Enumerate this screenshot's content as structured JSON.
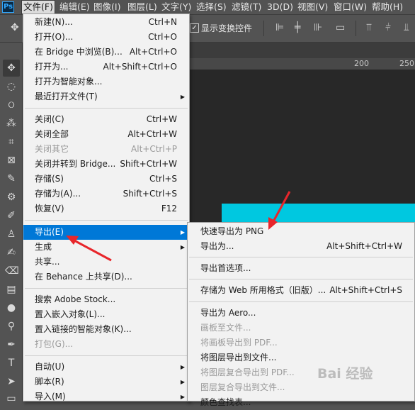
{
  "menubar": {
    "logo": "Ps",
    "items": [
      "文件(F)",
      "编辑(E)",
      "图像(I)",
      "图层(L)",
      "文字(Y)",
      "选择(S)",
      "滤镜(T)",
      "3D(D)",
      "视图(V)",
      "窗口(W)",
      "帮助(H)"
    ]
  },
  "options_bar": {
    "show_transform_label": "显示变换控件",
    "checked": true
  },
  "ruler": {
    "ticks": [
      "200",
      "250"
    ]
  },
  "file_menu": {
    "items": [
      {
        "label": "新建(N)...",
        "shortcut": "Ctrl+N"
      },
      {
        "label": "打开(O)...",
        "shortcut": "Ctrl+O"
      },
      {
        "label": "在 Bridge 中浏览(B)...",
        "shortcut": "Alt+Ctrl+O"
      },
      {
        "label": "打开为...",
        "shortcut": "Alt+Shift+Ctrl+O"
      },
      {
        "label": "打开为智能对象...",
        "shortcut": ""
      },
      {
        "label": "最近打开文件(T)",
        "shortcut": ""
      },
      {
        "label": "关闭(C)",
        "shortcut": "Ctrl+W"
      },
      {
        "label": "关闭全部",
        "shortcut": "Alt+Ctrl+W"
      },
      {
        "label": "关闭其它",
        "shortcut": "Alt+Ctrl+P"
      },
      {
        "label": "关闭并转到 Bridge...",
        "shortcut": "Shift+Ctrl+W"
      },
      {
        "label": "存储(S)",
        "shortcut": "Ctrl+S"
      },
      {
        "label": "存储为(A)...",
        "shortcut": "Shift+Ctrl+S"
      },
      {
        "label": "恢复(V)",
        "shortcut": "F12"
      },
      {
        "label": "导出(E)",
        "shortcut": ""
      },
      {
        "label": "生成",
        "shortcut": ""
      },
      {
        "label": "共享...",
        "shortcut": ""
      },
      {
        "label": "在 Behance 上共享(D)...",
        "shortcut": ""
      },
      {
        "label": "搜索 Adobe Stock...",
        "shortcut": ""
      },
      {
        "label": "置入嵌入对象(L)...",
        "shortcut": ""
      },
      {
        "label": "置入链接的智能对象(K)...",
        "shortcut": ""
      },
      {
        "label": "打包(G)...",
        "shortcut": ""
      },
      {
        "label": "自动(U)",
        "shortcut": ""
      },
      {
        "label": "脚本(R)",
        "shortcut": ""
      },
      {
        "label": "导入(M)",
        "shortcut": ""
      }
    ]
  },
  "export_submenu": {
    "items": [
      {
        "label": "快速导出为 PNG",
        "shortcut": ""
      },
      {
        "label": "导出为...",
        "shortcut": "Alt+Shift+Ctrl+W"
      },
      {
        "label": "导出首选项...",
        "shortcut": ""
      },
      {
        "label": "存储为 Web 所用格式（旧版）...",
        "shortcut": "Alt+Shift+Ctrl+S"
      },
      {
        "label": "导出为 Aero...",
        "shortcut": ""
      },
      {
        "label": "画板至文件...",
        "shortcut": ""
      },
      {
        "label": "将画板导出到 PDF...",
        "shortcut": ""
      },
      {
        "label": "将图层导出到文件...",
        "shortcut": ""
      },
      {
        "label": "将图层复合导出到 PDF...",
        "shortcut": ""
      },
      {
        "label": "图层复合导出到文件...",
        "shortcut": ""
      },
      {
        "label": "颜色查找表...",
        "shortcut": ""
      }
    ]
  },
  "watermark": "Bai 经验"
}
